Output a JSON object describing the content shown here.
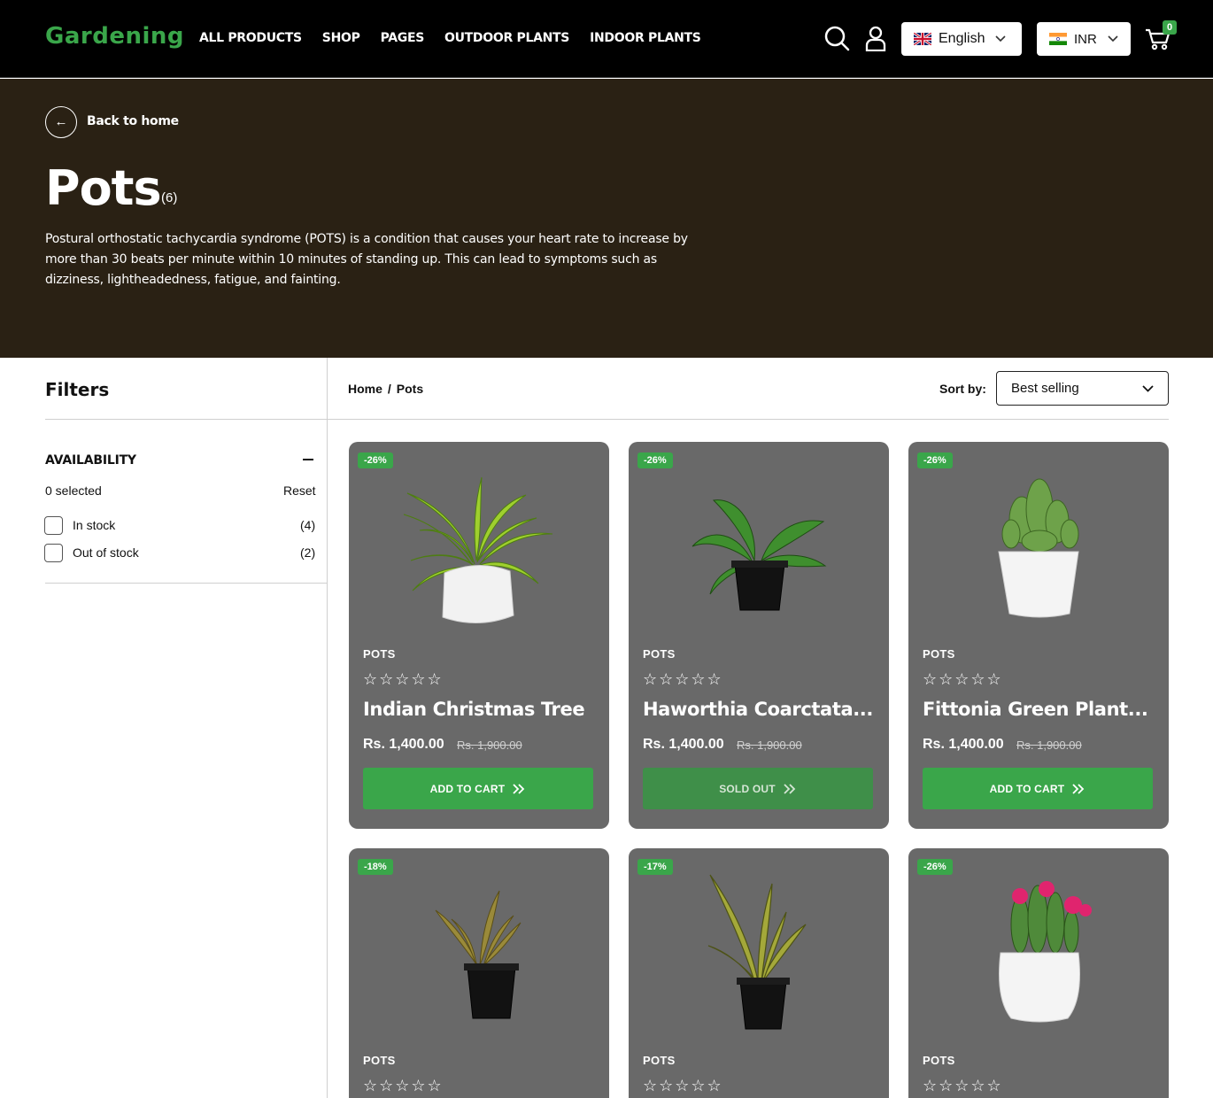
{
  "header": {
    "logo": "Gardening",
    "nav": [
      "ALL PRODUCTS",
      "SHOP",
      "PAGES",
      "OUTDOOR PLANTS",
      "INDOOR PLANTS"
    ],
    "language": "English",
    "currency": "INR",
    "cart_count": "0"
  },
  "hero": {
    "back_label": "Back to home",
    "back_arrow": "←",
    "title": "Pots",
    "count": "(6)",
    "description": "Postural orthostatic tachycardia syndrome (POTS) is a condition that causes your heart rate to increase by more than 30 beats per minute within 10 minutes of standing up. This can lead to symptoms such as dizziness, lightheadedness, fatigue, and fainting."
  },
  "filters": {
    "title": "Filters",
    "availability": {
      "title": "AVAILABILITY",
      "selected": "0 selected",
      "reset": "Reset",
      "options": [
        {
          "label": "In stock",
          "count": "(4)"
        },
        {
          "label": "Out of stock",
          "count": "(2)"
        }
      ]
    }
  },
  "toolbar": {
    "breadcrumb": [
      "Home",
      "/",
      "Pots"
    ],
    "sort_label": "Sort by:",
    "sort_value": "Best selling"
  },
  "products": [
    {
      "badge": "-26%",
      "category": "POTS",
      "stars": "☆☆☆☆☆",
      "name": "Indian Christmas Tree",
      "price": "Rs. 1,400.00",
      "old_price": "Rs. 1,900.00",
      "button": "ADD TO CART",
      "sold_out": false
    },
    {
      "badge": "-26%",
      "category": "POTS",
      "stars": "☆☆☆☆☆",
      "name": "Haworthia Coarctata...",
      "price": "Rs. 1,400.00",
      "old_price": "Rs. 1,900.00",
      "button": "SOLD OUT",
      "sold_out": true
    },
    {
      "badge": "-26%",
      "category": "POTS",
      "stars": "☆☆☆☆☆",
      "name": "Fittonia Green Plant...",
      "price": "Rs. 1,400.00",
      "old_price": "Rs. 1,900.00",
      "button": "ADD TO CART",
      "sold_out": false
    },
    {
      "badge": "-18%",
      "category": "POTS",
      "stars": "☆☆☆☆☆"
    },
    {
      "badge": "-17%",
      "category": "POTS",
      "stars": "☆☆☆☆☆"
    },
    {
      "badge": "-26%",
      "category": "POTS",
      "stars": "☆☆☆☆☆"
    }
  ],
  "colors": {
    "accent": "#3aa64a",
    "hero_bg": "#2a2114",
    "card_bg": "#696969"
  }
}
